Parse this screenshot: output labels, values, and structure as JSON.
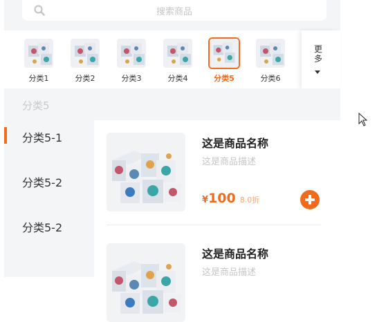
{
  "search": {
    "placeholder": "搜索商品",
    "icon": "search-icon"
  },
  "categories": [
    {
      "label": "分类1",
      "active": false
    },
    {
      "label": "分类2",
      "active": false
    },
    {
      "label": "分类3",
      "active": false
    },
    {
      "label": "分类4",
      "active": false
    },
    {
      "label": "分类5",
      "active": true
    },
    {
      "label": "分类6",
      "active": false
    }
  ],
  "more": {
    "label": "更多",
    "icon": "caret-down-icon"
  },
  "section": {
    "title": "分类5"
  },
  "subnav": [
    {
      "label": "分类5-1",
      "active": true
    },
    {
      "label": "分类5-2",
      "active": false
    },
    {
      "label": "分类5-2",
      "active": false
    }
  ],
  "products": [
    {
      "name": "这是商品名称",
      "desc": "这是商品描述",
      "currency": "¥",
      "price": "100",
      "discount": "8.0折"
    },
    {
      "name": "这是商品名称",
      "desc": "这是商品描述"
    }
  ],
  "colors": {
    "accent": "#f26b1d",
    "background": "#f4f5f7",
    "muted": "#c6c6c6"
  }
}
